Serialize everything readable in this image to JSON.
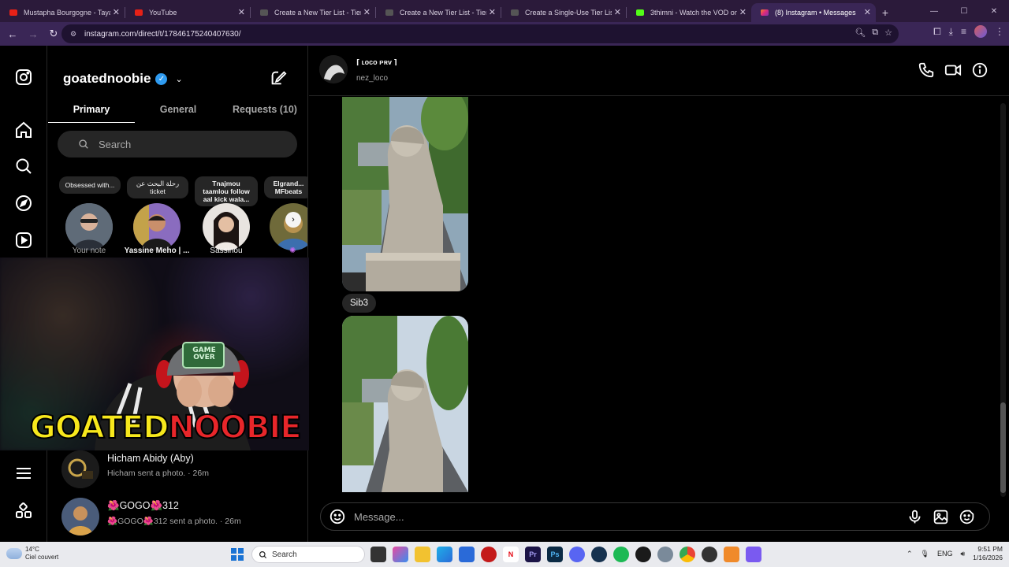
{
  "browser": {
    "tabs": [
      {
        "title": "Mustapha Bourgogne - Tayara",
        "favicon_color": "#e62117"
      },
      {
        "title": "YouTube",
        "favicon_color": "#e62117"
      },
      {
        "title": "Create a New Tier List - TierMa",
        "favicon_color": "#3a3a3a"
      },
      {
        "title": "Create a New Tier List - TierMa",
        "favicon_color": "#3a3a3a"
      },
      {
        "title": "Create a Single-Use Tier List (P",
        "favicon_color": "#3a3a3a"
      },
      {
        "title": "3thimni - Watch the VOD on Ki",
        "favicon_color": "#53fc18"
      },
      {
        "title": "(8) Instagram • Messages",
        "favicon_color": "#dd2a7b"
      }
    ],
    "url": "instagram.com/direct/t/17846175240407630/"
  },
  "inbox": {
    "account_name": "goatednoobie",
    "tabs": [
      "Primary",
      "General",
      "Requests (10)"
    ],
    "search_placeholder": "Search",
    "notes": [
      {
        "bubble": "Obsessed with...",
        "label": "Your note"
      },
      {
        "bubble": "رحلة البحث عن ticket",
        "label": "Yassine Meho | ..."
      },
      {
        "bubble": "Tnajmou taamlou follow aal kick wala...",
        "label": "Sassinou"
      },
      {
        "bubble": "Elgrand... MFbeats",
        "label": ""
      }
    ],
    "threads": [
      {
        "name": "Hicham Abidy (Aby)",
        "preview": "Hicham sent a photo. · 26m"
      },
      {
        "name": "🌺GOGO🌺312",
        "preview": "🌺GOGO🌺312 sent a photo. · 26m"
      }
    ]
  },
  "overlay": {
    "brand_first": "GOATED",
    "brand_second": "NOOBIE",
    "cap_text": "GAME OVER"
  },
  "chat": {
    "display_name": "⌈ ʟᴏᴄᴏ ᴘʀᴠ ⌉",
    "username": "nez_loco",
    "messages": [
      {
        "type": "photo"
      },
      {
        "type": "text",
        "text": "Sib3"
      },
      {
        "type": "photo"
      }
    ],
    "composer_placeholder": "Message..."
  },
  "taskbar": {
    "weather_temp": "14°C",
    "weather_desc": "Ciel couvert",
    "search_label": "Search",
    "lang": "ENG",
    "time": "9:51 PM",
    "date": "1/16/2026"
  }
}
